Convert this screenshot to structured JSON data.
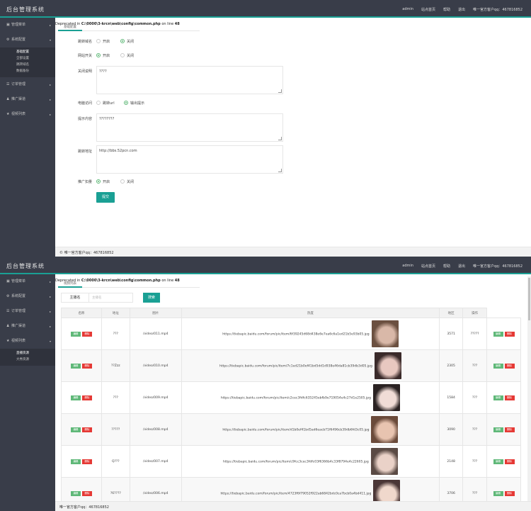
{
  "app": {
    "title": "后台管理系统",
    "owner": "admin"
  },
  "nav": {
    "items": [
      "admin",
      "站点首页",
      "帮助",
      "退出",
      "唯一官方客户qq：467816852"
    ]
  },
  "sidebar1": {
    "items": [
      {
        "icon": "home-icon",
        "label": "管理菜单"
      },
      {
        "icon": "settings-icon",
        "label": "系统配置"
      },
      {
        "icon": "list-icon",
        "label": "订单管理"
      },
      {
        "icon": "user-icon",
        "label": "推广渠道"
      },
      {
        "icon": "star-icon",
        "label": "视频列表"
      }
    ],
    "sub": [
      "基础配置",
      "全部设置",
      "跳转域名",
      "数据备份"
    ]
  },
  "sidebar2": {
    "items": [
      {
        "icon": "home-icon",
        "label": "管理菜单"
      },
      {
        "icon": "settings-icon",
        "label": "系统配置"
      },
      {
        "icon": "list-icon",
        "label": "订单管理"
      },
      {
        "icon": "user-icon",
        "label": "推广渠道"
      },
      {
        "icon": "star-icon",
        "label": "视频列表"
      }
    ],
    "sub": [
      "直播资源",
      "大秀资源"
    ]
  },
  "warning": {
    "prefix": "Deprecated",
    "file": "C:\\0000\\3-krcn\\web\\config\\common.php",
    "mid": "on line",
    "line": "48"
  },
  "tab1": "基础配置",
  "tab2": "视频列表",
  "form": {
    "domain_jump": {
      "label": "跳转域名",
      "opt1": "开启",
      "opt2": "关闭",
      "selected": "关闭"
    },
    "site_switch": {
      "label": "网站开关",
      "opt1": "开启",
      "opt2": "关闭",
      "selected": "开启"
    },
    "close_note": {
      "label": "关闭说明",
      "value": "????"
    },
    "pc_access": {
      "label": "电脑访问",
      "opt1": "跳转url",
      "opt2": "输出提示",
      "selected": "输出提示"
    },
    "tip_content": {
      "label": "提示内容",
      "value": "????????"
    },
    "jump_url": {
      "label": "跳转地址",
      "value": "http://bbs.52pcn.com"
    },
    "promo_deduct": {
      "label": "推广扣量",
      "opt1": "开启",
      "opt2": "关闭",
      "selected": "开启"
    },
    "submit": "提交"
  },
  "footer": "© 唯一官方客户qq：467816852",
  "footer2": "唯一官方客户qq：467816852",
  "search": {
    "label": "主播名",
    "placeholder": "主播名",
    "button": "搜索"
  },
  "table": {
    "headers": [
      "名称",
      "地址",
      "图片",
      "热度",
      "地区",
      "操作"
    ],
    "edit": "编辑",
    "delete": "删除",
    "rows": [
      {
        "name": "???",
        "addr": "/video/011.mp4",
        "img": "https://tiebapic.baidu.com/forum/pic/item/6f39245d68d438e6e7ea6c6a1ed21b5e93b05.jpg",
        "heat": "3571",
        "region": "?????",
        "c1": "#6b5040",
        "c2": "#d9b8a8"
      },
      {
        "name": "??Zzz",
        "addr": "/video/010.mp4",
        "img": "https://tiebapic.baidu.com/forum/pic/item/7c1ed21b0ef41bd5dd1d938e46da81cb39db3d05.jpg",
        "heat": "2305",
        "region": "???",
        "c1": "#3a2a2a",
        "c2": "#e8c8c0"
      },
      {
        "name": "???",
        "addr": "/video/009.mp4",
        "img": "https://tiebapic.baidu.com/forum/pic/item/c2cec3fdfc635245ebfb9e719054e4c27d1e2505.jpg",
        "heat": "1584",
        "region": "???",
        "c1": "#2a2222",
        "c2": "#f0dcd6"
      },
      {
        "name": "?????",
        "addr": "/video/008.mp4",
        "img": "https://tiebapic.baidu.com/forum/pic/item/d1b0ef41bd5ad6eacb71f6496cb39db6fd3c05.jpg",
        "heat": "3090",
        "region": "???",
        "c1": "#6a4a3a",
        "c2": "#e8c4b0"
      },
      {
        "name": "Q???",
        "addr": "/video/007.mp4",
        "img": "https://tiebapic.baidu.com/forum/pic/item/c9fcc3cec3fdfc03f6366b4c33f8794e4c22605.jpg",
        "heat": "2148",
        "region": "???",
        "c1": "#5a4a44",
        "c2": "#ead2c8"
      },
      {
        "name": "?6????",
        "addr": "/video/006.mp4",
        "img": "https://tiebapic.baidu.com/forum/pic/item/4723f6f79052f922ab6842bdc0ca7bcb0a4bd411.jpg",
        "heat": "3706",
        "region": "???",
        "c1": "#4a3636",
        "c2": "#f0d8cc"
      }
    ]
  }
}
